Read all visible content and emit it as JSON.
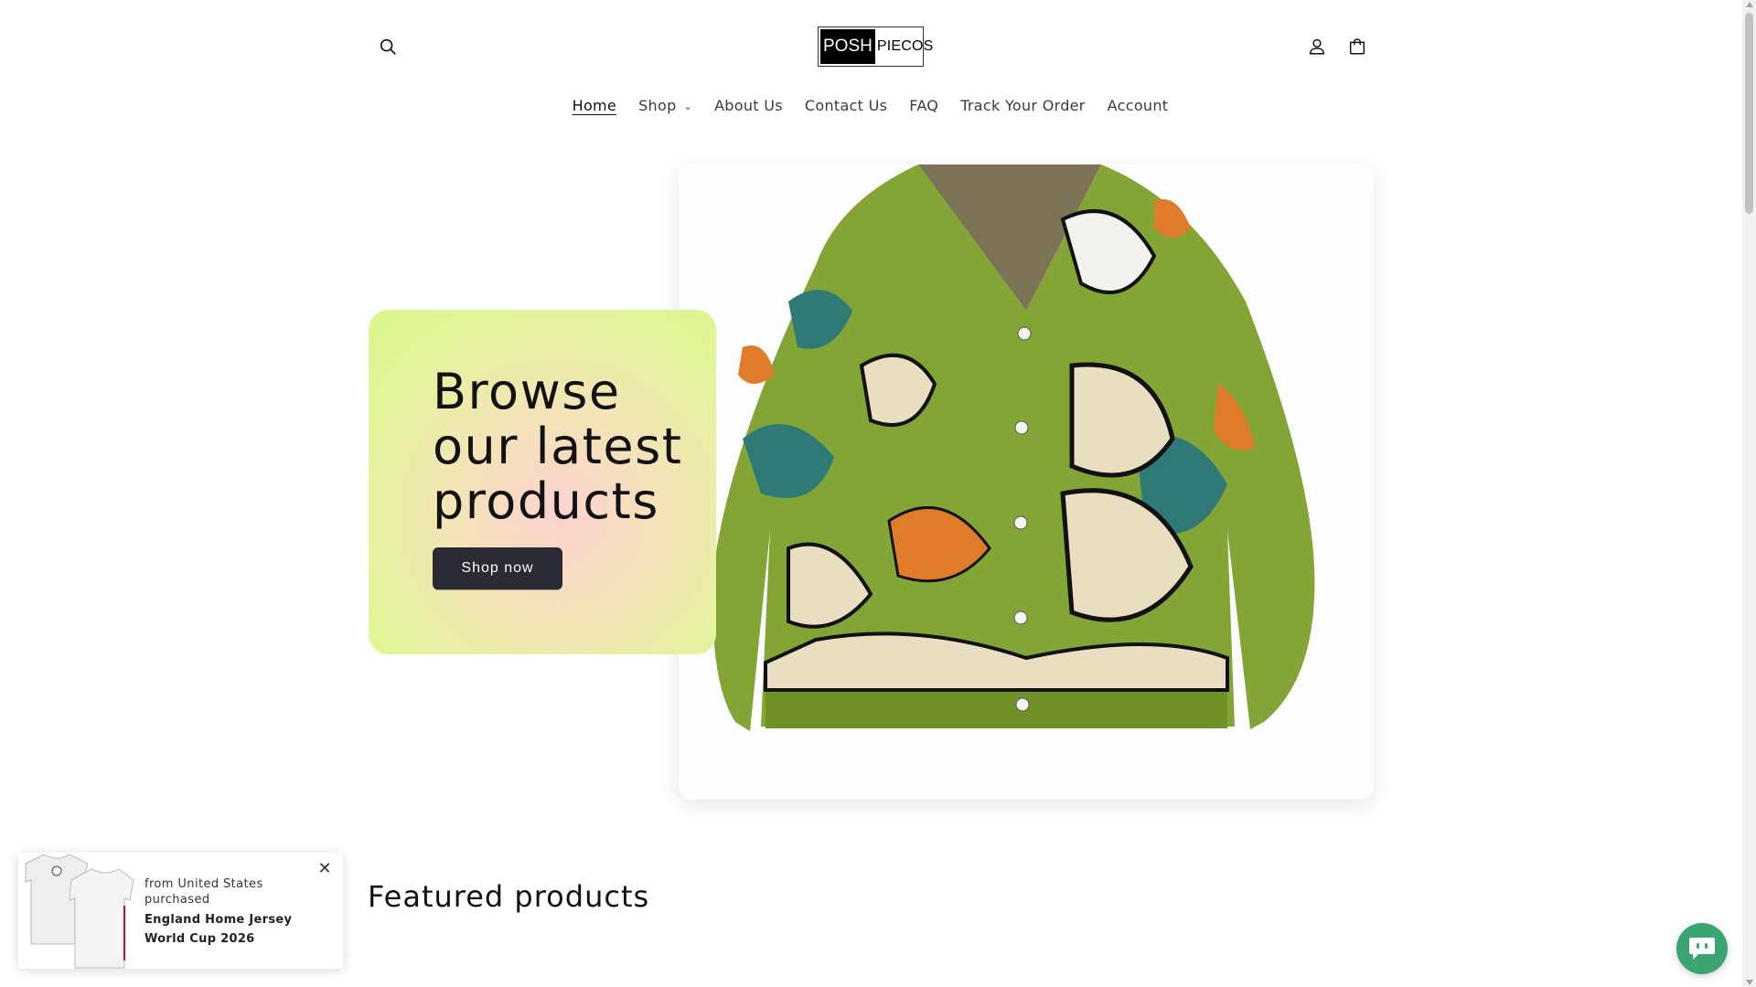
{
  "header": {
    "logo": {
      "part1": "POSH",
      "part2": "PIECOS"
    },
    "icons": {
      "search": "search-icon",
      "account": "user-icon",
      "cart": "cart-icon"
    }
  },
  "nav": {
    "items": [
      {
        "label": "Home",
        "active": true
      },
      {
        "label": "Shop",
        "dropdown": true
      },
      {
        "label": "About Us"
      },
      {
        "label": "Contact Us"
      },
      {
        "label": "FAQ"
      },
      {
        "label": "Track Your Order"
      },
      {
        "label": "Account"
      }
    ]
  },
  "hero": {
    "title": "Browse our latest products",
    "button_label": "Shop now",
    "colors": {
      "button": "#2a2a35",
      "card_gradient": [
        "#fbd2d0",
        "#daf58a"
      ]
    }
  },
  "featured": {
    "title": "Featured products"
  },
  "popup": {
    "from_text": "from United States purchased",
    "product": "England Home Jersey World Cup 2026"
  },
  "chat": {
    "icon": "chat-bot-icon",
    "color": "#3aa570"
  }
}
